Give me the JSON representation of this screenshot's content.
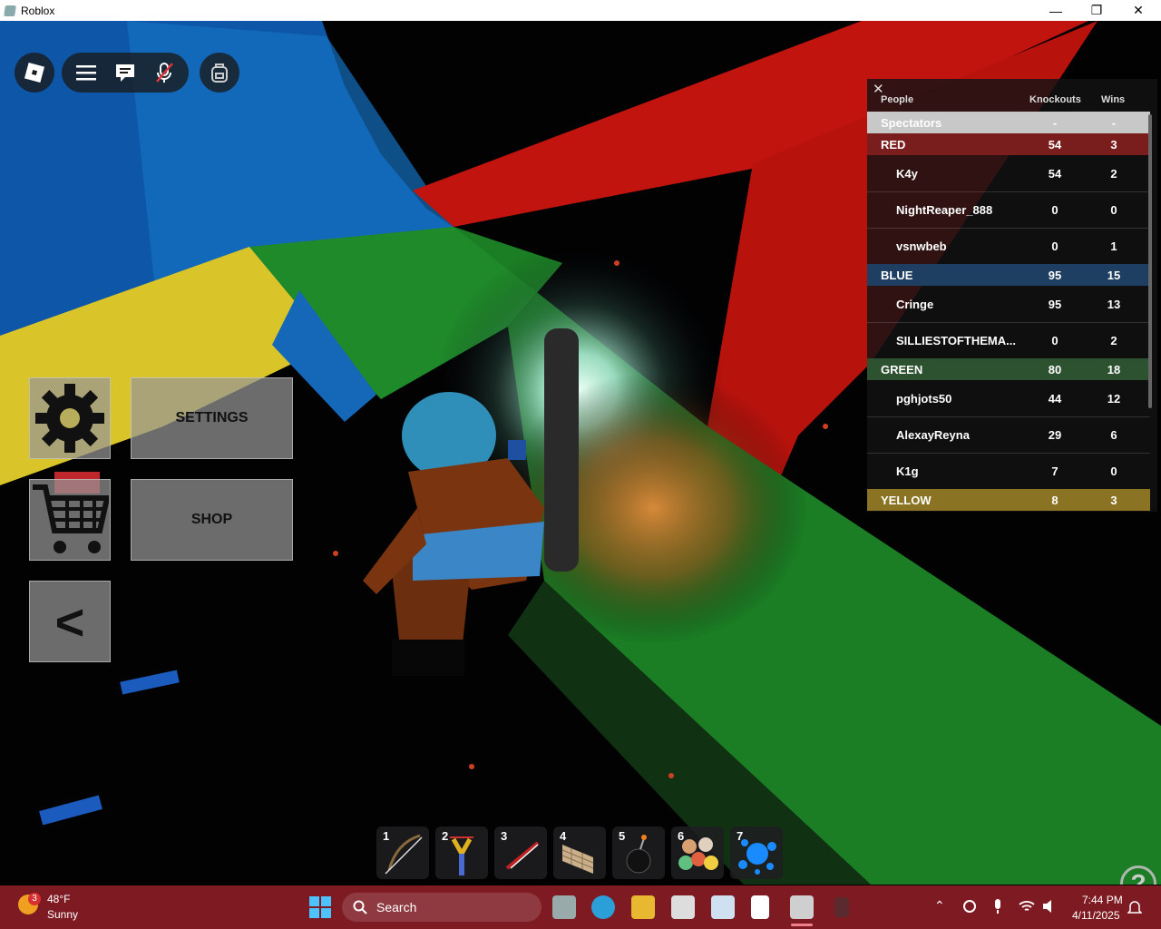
{
  "window": {
    "title": "Roblox",
    "minimize": "—",
    "maximize": "❐",
    "close": "✕"
  },
  "menu": {
    "settings_label": "SETTINGS",
    "shop_label": "SHOP",
    "collapse_label": "<"
  },
  "leaderboard": {
    "close": "✕",
    "headers": {
      "people": "People",
      "knockouts": "Knockouts",
      "wins": "Wins"
    },
    "rows": [
      {
        "type": "team",
        "name": "Spectators",
        "knockouts": "-",
        "wins": "-",
        "color": "#c8c8c8"
      },
      {
        "type": "team",
        "name": "RED",
        "knockouts": "54",
        "wins": "3",
        "color": "#7a1d1d"
      },
      {
        "type": "player",
        "name": "K4y",
        "knockouts": "54",
        "wins": "2"
      },
      {
        "type": "player",
        "name": "NightReaper_888",
        "knockouts": "0",
        "wins": "0"
      },
      {
        "type": "player",
        "name": "vsnwbeb",
        "knockouts": "0",
        "wins": "1"
      },
      {
        "type": "team",
        "name": "BLUE",
        "knockouts": "95",
        "wins": "15",
        "color": "#1e3f62"
      },
      {
        "type": "player",
        "name": "Cringe",
        "knockouts": "95",
        "wins": "13"
      },
      {
        "type": "player",
        "name": "SILLIESTOFTHEMA...",
        "knockouts": "0",
        "wins": "2"
      },
      {
        "type": "team",
        "name": "GREEN",
        "knockouts": "80",
        "wins": "18",
        "color": "#2d5230"
      },
      {
        "type": "player",
        "name": "pghjots50",
        "knockouts": "44",
        "wins": "12"
      },
      {
        "type": "player",
        "name": "AlexayReyna",
        "knockouts": "29",
        "wins": "6"
      },
      {
        "type": "player",
        "name": "K1g",
        "knockouts": "7",
        "wins": "0"
      },
      {
        "type": "team",
        "name": "YELLOW",
        "knockouts": "8",
        "wins": "3",
        "color": "#8a7424"
      }
    ]
  },
  "hotbar": [
    {
      "num": "1",
      "icon": "bow-icon"
    },
    {
      "num": "2",
      "icon": "slingshot-icon"
    },
    {
      "num": "3",
      "icon": "sword-icon"
    },
    {
      "num": "4",
      "icon": "wall-icon"
    },
    {
      "num": "5",
      "icon": "bomb-icon"
    },
    {
      "num": "6",
      "icon": "balls-icon"
    },
    {
      "num": "7",
      "icon": "paint-splat-icon"
    }
  ],
  "help": "?",
  "taskbar": {
    "weather_badge": "3",
    "temperature": "48°F",
    "condition": "Sunny",
    "search_label": "Search",
    "time": "7:44 PM",
    "date": "4/11/2025"
  }
}
